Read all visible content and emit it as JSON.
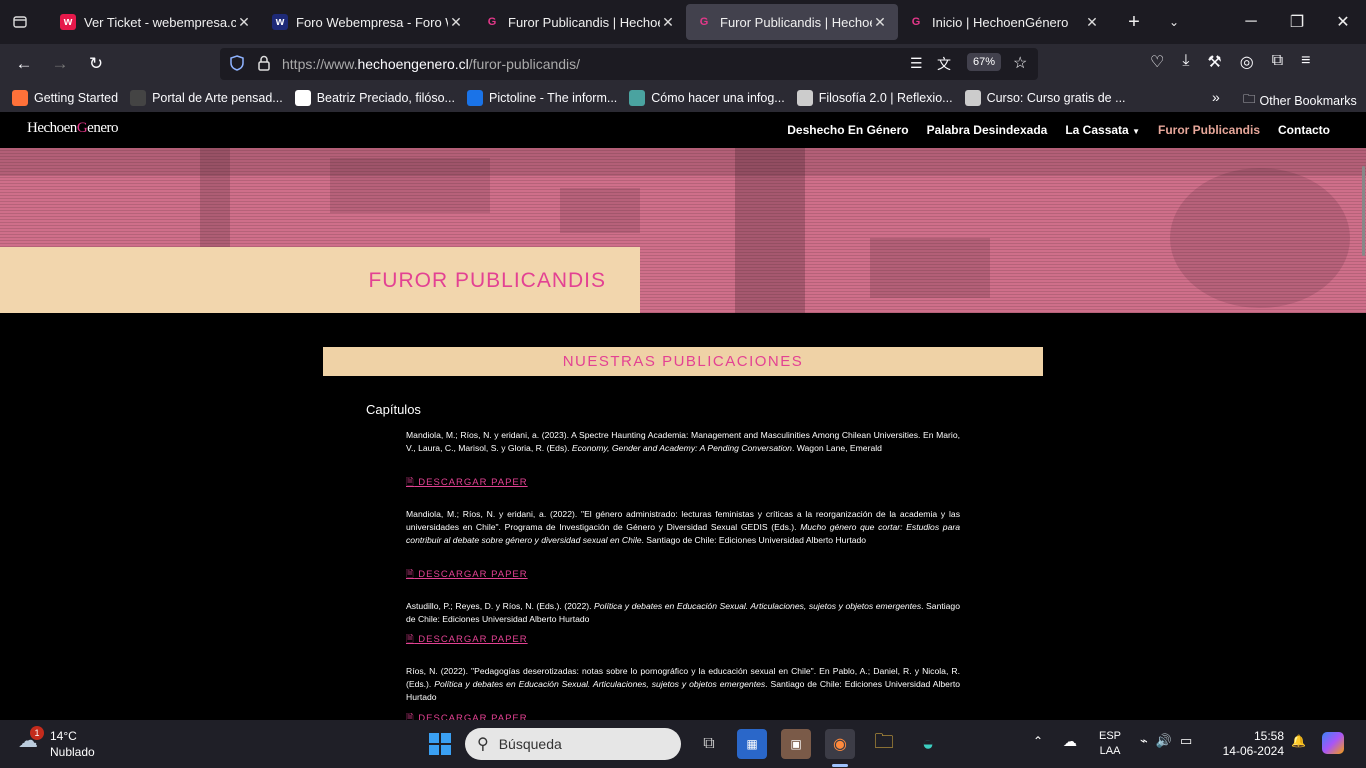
{
  "tabs": [
    {
      "title": "Ver Ticket - webempresa.com",
      "fav": "w",
      "fav_color": "#e6194b",
      "active": false
    },
    {
      "title": "Foro Webempresa - Foro Wor",
      "fav": "w",
      "fav_color": "#1e2a78",
      "active": false
    },
    {
      "title": "Furor Publicandis | HechoenG",
      "fav": "G",
      "fav_color": "#e6388b",
      "active": false
    },
    {
      "title": "Furor Publicandis | HechoenG",
      "fav": "G",
      "fav_color": "#e6388b",
      "active": true
    },
    {
      "title": "Inicio | HechoenGénero",
      "fav": "G",
      "fav_color": "#e6388b",
      "active": false
    }
  ],
  "url": {
    "prefix": "https://www.",
    "domain": "hechoengenero.cl",
    "path": "/furor-publicandis/"
  },
  "zoom": "67%",
  "bookmarks": [
    {
      "label": "Getting Started",
      "icon": "firefox-icon"
    },
    {
      "label": "Portal de Arte pensad...",
      "icon": "s-icon"
    },
    {
      "label": "Beatriz Preciado, filóso...",
      "icon": "w-icon"
    },
    {
      "label": "Pictoline - The inform...",
      "icon": "bird-icon"
    },
    {
      "label": "Cómo hacer una infog...",
      "icon": "swirl-icon"
    },
    {
      "label": "Filosofía 2.0 | Reflexio...",
      "icon": "globe-icon"
    },
    {
      "label": "Curso: Curso gratis de ...",
      "icon": "book-icon"
    }
  ],
  "other_bookmarks": "Other Bookmarks",
  "site": {
    "logo_a": "Hechoen",
    "logo_g": "G",
    "logo_b": "enero",
    "menu": [
      "Deshecho En Género",
      "Palabra Desindexada",
      "La Cassata",
      "Furor Publicandis",
      "Contacto"
    ],
    "hero_title": "FUROR PUBLICANDIS",
    "section_title": "NUESTRAS PUBLICACIONES",
    "subheading": "Capítulos",
    "download_label": " DESCARGAR PAPER",
    "pubs": [
      {
        "a": "Mandiola, M.; Ríos, N. y eridani, a. (2023). A Spectre Haunting Academia: Management and Masculinities Among Chilean Universities. En Mario, V., Laura, C., Marisol, S. y Gloria, R. (Eds). ",
        "i": "Economy, Gender and Academy: A Pending Conversation",
        "b": ". Wagon Lane, Emerald"
      },
      {
        "a": "Mandiola, M.; Ríos, N. y eridani, a. (2022). \"El género administrado: lecturas feministas y críticas a la reorganización de la academia y las universidades en Chile\". Programa de Investigación de Género y Diversidad Sexual GEDIS (Eds.). ",
        "i": "Mucho género que cortar: Estudios para contribuir al debate sobre género y diversidad sexual en Chile",
        "b": ". Santiago de Chile: Ediciones Universidad Alberto Hurtado"
      },
      {
        "a": "Astudillo, P.; Reyes, D. y Ríos, N. (Eds.). (2022). ",
        "i": "Política y debates en Educación Sexual. Articulaciones, sujetos y objetos emergentes",
        "b": ". Santiago de Chile: Ediciones Universidad Alberto Hurtado"
      },
      {
        "a": "Ríos, N. (2022). \"Pedagogías deserotizadas: notas sobre lo pornográfico y la educación sexual en Chile\". En Pablo, A.; Daniel, R. y Nicola, R. (Eds.). ",
        "i": "Política y debates en Educación Sexual. Articulaciones, sujetos y objetos emergentes",
        "b": ". Santiago de Chile: Ediciones Universidad Alberto Hurtado"
      }
    ]
  },
  "taskbar": {
    "weather_temp": "14°C",
    "weather_desc": "Nublado",
    "weather_badge": "1",
    "search_placeholder": "Búsqueda",
    "lang_a": "ESP",
    "lang_b": "LAA",
    "time": "15:58",
    "date": "14-06-2024"
  }
}
